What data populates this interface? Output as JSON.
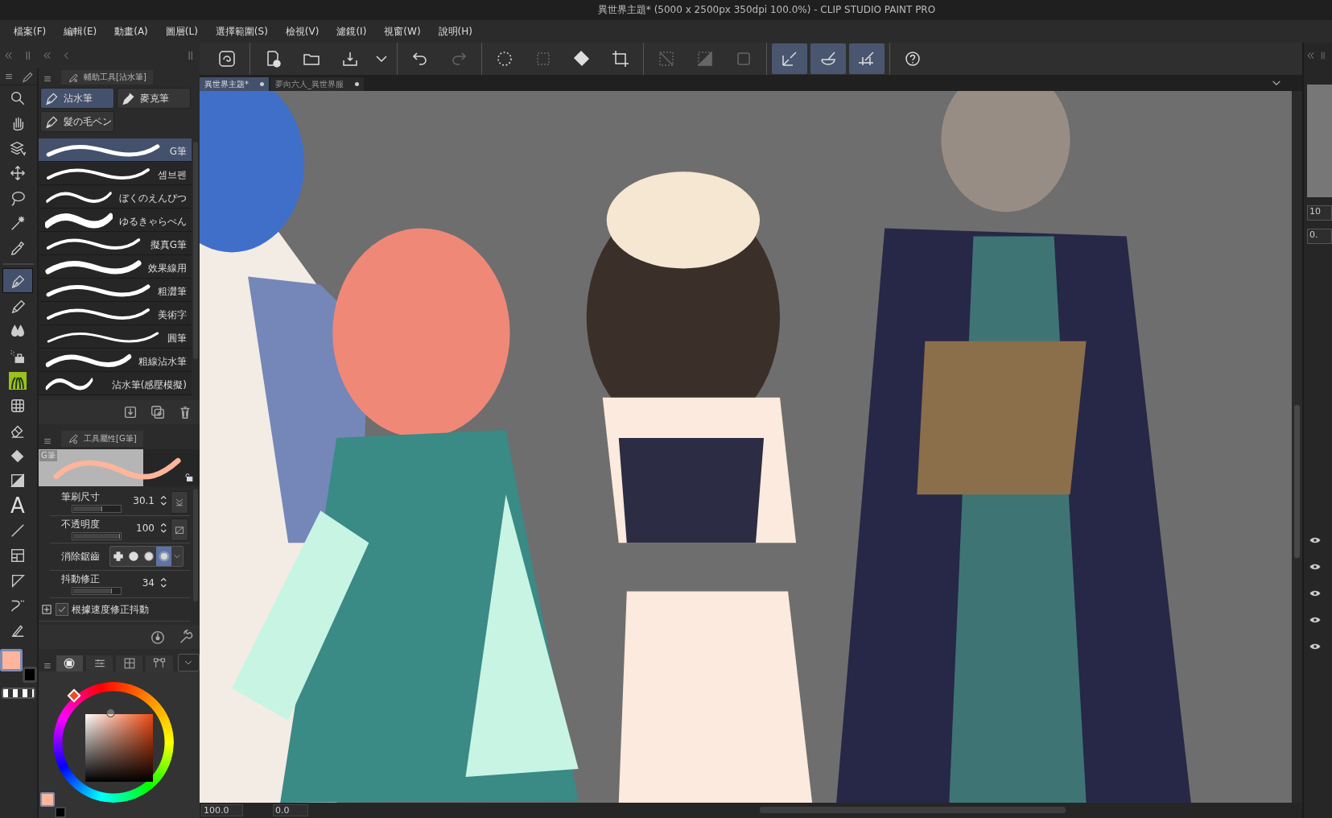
{
  "window": {
    "title": "異世界主題* (5000 x 2500px 350dpi 100.0%)  - CLIP STUDIO PAINT PRO"
  },
  "menu": [
    "檔案(F)",
    "編輯(E)",
    "動畫(A)",
    "圖層(L)",
    "選擇範圍(S)",
    "檢視(V)",
    "濾鏡(I)",
    "視窗(W)",
    "說明(H)"
  ],
  "toolbar": [
    [
      {
        "kind": "logo",
        "disabled": false,
        "selected": false
      }
    ],
    [
      {
        "kind": "new",
        "disabled": false,
        "selected": false
      },
      {
        "kind": "open",
        "disabled": false,
        "selected": false
      },
      {
        "kind": "export",
        "disabled": false,
        "selected": false
      },
      {
        "kind": "dropdown",
        "disabled": false,
        "selected": false
      }
    ],
    [
      {
        "kind": "undo",
        "disabled": false,
        "selected": false
      },
      {
        "kind": "redo",
        "disabled": true,
        "selected": false
      }
    ],
    [
      {
        "kind": "select-all",
        "disabled": false,
        "selected": false
      },
      {
        "kind": "deselect",
        "disabled": true,
        "selected": false
      },
      {
        "kind": "fill",
        "disabled": false,
        "selected": false
      },
      {
        "kind": "transform",
        "disabled": false,
        "selected": false
      }
    ],
    [
      {
        "kind": "invert",
        "disabled": true,
        "selected": false
      },
      {
        "kind": "gradient",
        "disabled": true,
        "selected": false
      },
      {
        "kind": "border",
        "disabled": true,
        "selected": false
      }
    ],
    [
      {
        "kind": "snap-ruler",
        "disabled": false,
        "selected": true
      },
      {
        "kind": "snap-special",
        "disabled": false,
        "selected": true
      },
      {
        "kind": "snap-grid",
        "disabled": false,
        "selected": true
      }
    ],
    [
      {
        "kind": "help",
        "disabled": false,
        "selected": false
      }
    ]
  ],
  "tools": [
    {
      "kind": "zoom",
      "selected": false
    },
    {
      "kind": "hand",
      "selected": false
    },
    {
      "kind": "layer-select",
      "selected": false
    },
    {
      "kind": "move",
      "selected": false
    },
    {
      "kind": "lasso",
      "selected": false
    },
    {
      "kind": "wand",
      "selected": false
    },
    {
      "kind": "eyedropper",
      "selected": false
    },
    {
      "kind": "pen",
      "selected": true
    },
    {
      "kind": "pencil",
      "selected": false
    },
    {
      "kind": "blend",
      "selected": false
    },
    {
      "kind": "airbrush",
      "selected": false
    },
    {
      "kind": "decoration",
      "selected": false
    },
    {
      "kind": "figure",
      "selected": false
    },
    {
      "kind": "eraser",
      "selected": false
    },
    {
      "kind": "fill",
      "selected": false
    },
    {
      "kind": "gradient",
      "selected": false
    },
    {
      "kind": "text",
      "selected": false,
      "glyph": "A"
    },
    {
      "kind": "line",
      "selected": false
    },
    {
      "kind": "frame",
      "selected": false
    },
    {
      "kind": "ruler",
      "selected": false
    },
    {
      "kind": "correction",
      "selected": false
    },
    {
      "kind": "line-brush",
      "selected": false
    }
  ],
  "colors": {
    "main": {
      "color": "#ffb49c"
    },
    "sub": {
      "color": "#000000"
    }
  },
  "color_panel": {
    "tabs": [
      {
        "selected": true
      },
      {
        "selected": false
      },
      {
        "selected": false
      },
      {
        "selected": false
      }
    ]
  },
  "subtool_panel": {
    "title": "輔助工具[沾水筆]",
    "groups": [
      {
        "label": "沾水筆",
        "selected": true
      },
      {
        "label": "麥克筆",
        "selected": false
      },
      {
        "label": "髮の毛ペン",
        "selected": false
      }
    ],
    "brushes": [
      {
        "label": "G筆",
        "selected": true
      },
      {
        "label": "셈브펜",
        "selected": false
      },
      {
        "label": "ぼくのえんぴつ",
        "selected": false
      },
      {
        "label": "ゆるきゃらぺん",
        "selected": false
      },
      {
        "label": "擬真G筆",
        "selected": false
      },
      {
        "label": "效果線用",
        "selected": false
      },
      {
        "label": "粗澀筆",
        "selected": false
      },
      {
        "label": "美術字",
        "selected": false
      },
      {
        "label": "圓筆",
        "selected": false
      },
      {
        "label": "粗線沾水筆",
        "selected": false
      },
      {
        "label": "沾水筆(感壓模擬)",
        "selected": false
      }
    ]
  },
  "tool_property": {
    "title": "工具屬性[G筆]",
    "preview_label": "G筆",
    "rows": [
      {
        "kind": "slider",
        "label": "筆刷尺寸",
        "value": "30.1",
        "level": 0.62
      },
      {
        "kind": "slider",
        "label": "不透明度",
        "value": "100",
        "level": 1
      },
      {
        "kind": "choice",
        "label": "消除鋸齒",
        "options": [
          {
            "kind": "none",
            "selected": false
          },
          {
            "kind": "weak",
            "selected": false
          },
          {
            "kind": "medium",
            "selected": false
          },
          {
            "kind": "strong",
            "selected": true
          }
        ]
      },
      {
        "kind": "slider",
        "label": "抖動修正",
        "value": "34",
        "level": 0.82
      },
      {
        "kind": "checkbox",
        "label": "根據速度修正抖動",
        "checked": true
      }
    ]
  },
  "document_tabs": [
    {
      "label": "異世界主題*",
      "selected": true,
      "modified": true
    },
    {
      "label": "夢向六人_異世界服",
      "selected": false,
      "modified": true
    }
  ],
  "canvas": {
    "kind": "picture"
  },
  "status_bar": {
    "zoom": "100.0",
    "angle": "0.0"
  },
  "right_panel": {
    "fields": [
      "10",
      "0."
    ]
  }
}
